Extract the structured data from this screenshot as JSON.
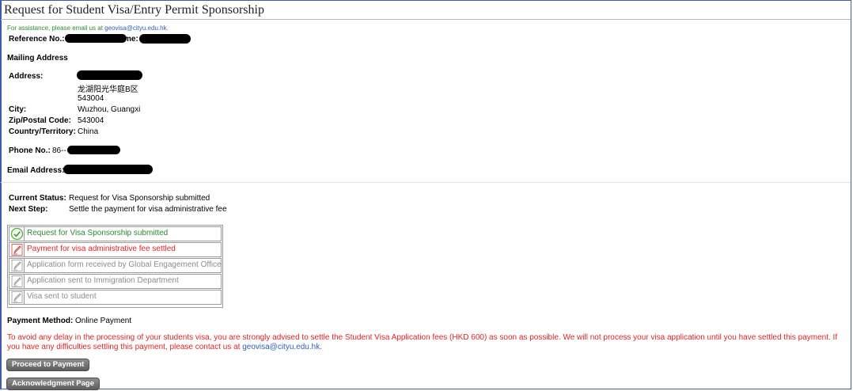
{
  "page": {
    "title": "Request for Student Visa/Entry Permit Sponsorship",
    "assistance_text": "For assistance, please email us at ",
    "assistance_email": "geovisa@cityu.edu.hk",
    "assistance_suffix": "."
  },
  "reference": {
    "label": "Reference No.:",
    "name_label_fragment": "me:"
  },
  "mailing": {
    "heading": "Mailing Address",
    "address_label": "Address:",
    "address_line2": "龙湖阳光华庭B区",
    "address_line3": "543004",
    "city_label": "City:",
    "city_value": "Wuzhou, Guangxi",
    "zip_label": "Zip/Postal Code:",
    "zip_value": "543004",
    "country_label": "Country/Territory:",
    "country_value": "China"
  },
  "contact": {
    "phone_label": "Phone No.:",
    "phone_prefix": "86--",
    "email_label": "Email Address:"
  },
  "status": {
    "current_label": "Current Status:",
    "current_value": "Request for Visa Sponsorship submitted",
    "next_label": "Next Step:",
    "next_value": "Settle the payment for visa administrative fee"
  },
  "steps": [
    {
      "label": "Request for Visa Sponsorship submitted",
      "state": "done",
      "color": "#2e8b2e"
    },
    {
      "label": "Payment for visa administrative fee settled",
      "state": "current",
      "color": "#e02424"
    },
    {
      "label": "Application form received by Global Engagement Office",
      "state": "pending",
      "color": "#8c8c8c"
    },
    {
      "label": "Application sent to Immigration Department",
      "state": "pending",
      "color": "#8c8c8c"
    },
    {
      "label": "Visa sent to student",
      "state": "pending",
      "color": "#8c8c8c"
    }
  ],
  "payment": {
    "method_label": "Payment Method:",
    "method_value": "Online Payment",
    "warning_text": "To avoid any delay in the processing of your students visa, you are strongly advised to settle the Student Visa Application fees (HKD 600) as soon as possible. We will not process your visa application until you have settled this payment. If you have any difficulties settling this payment, please contact us at ",
    "warning_email": "geovisa@cityu.edu.hk",
    "warning_suffix": "."
  },
  "buttons": {
    "proceed": "Proceed to Payment",
    "acknowledgment": "Acknowledgment Page"
  },
  "colors": {
    "accent": "#2f62b8",
    "success": "#2e8b2e",
    "alert": "#e02424",
    "muted": "#8c8c8c"
  }
}
